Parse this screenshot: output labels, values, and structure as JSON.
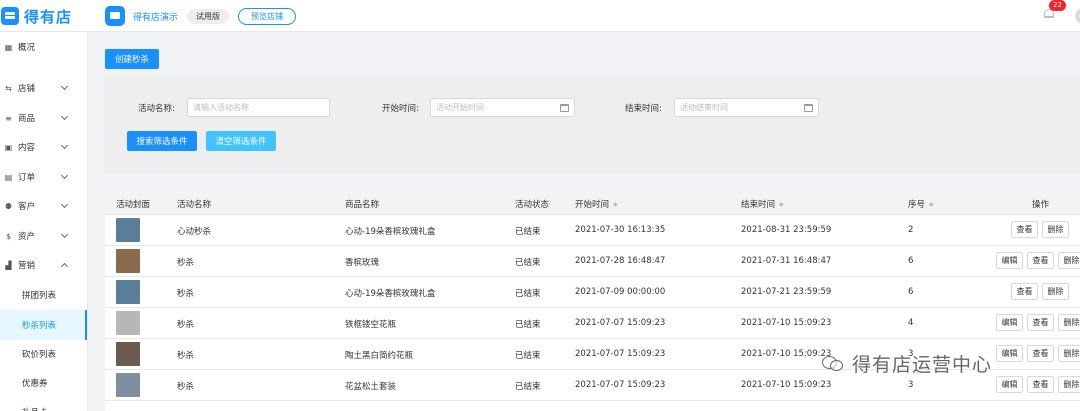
{
  "header": {
    "brand": "得有店",
    "store_name": "得有店演示",
    "trial_label": "试用版",
    "preview_label": "预览店铺",
    "notification_count": "22"
  },
  "sidebar": {
    "items": [
      {
        "icon": "grid-icon",
        "glyph": "▦",
        "label": "概况"
      },
      {
        "icon": "store-icon",
        "glyph": "⇆",
        "label": "店铺"
      },
      {
        "icon": "product-icon",
        "glyph": "≡",
        "label": "商品"
      },
      {
        "icon": "content-icon",
        "glyph": "▣",
        "label": "内容"
      },
      {
        "icon": "order-icon",
        "glyph": "▤",
        "label": "订单"
      },
      {
        "icon": "customer-icon",
        "glyph": "⚉",
        "label": "客户"
      },
      {
        "icon": "asset-icon",
        "glyph": "$",
        "label": "资产"
      },
      {
        "icon": "marketing-icon",
        "glyph": "▟",
        "label": "营销"
      }
    ],
    "sub_items": [
      "拼团列表",
      "秒杀列表",
      "砍价列表",
      "优惠券",
      "礼品卡"
    ]
  },
  "toolbar": {
    "create_label": "创建秒杀"
  },
  "filters": {
    "name_label": "活动名称:",
    "name_placeholder": "请输入活动名称",
    "start_label": "开始时间:",
    "start_placeholder": "活动开始时间",
    "end_label": "结束时间:",
    "end_placeholder": "活动结束时间",
    "search_label": "搜索筛选条件",
    "clear_label": "清空筛选条件"
  },
  "table": {
    "headers": [
      "活动封面",
      "活动名称",
      "商品名称",
      "活动状态",
      "开始时间",
      "结束时间",
      "序号",
      "操作"
    ],
    "rows": [
      {
        "name": "心动秒杀",
        "product": "心动-19朵香槟玫瑰礼盒",
        "status": "已结束",
        "start": "2021-07-30 16:13:35",
        "end": "2021-08-31 23:59:59",
        "seq": "2",
        "thumb": "#5a7d9a",
        "edit": false
      },
      {
        "name": "秒杀",
        "product": "香槟玫瑰",
        "status": "已结束",
        "start": "2021-07-28 16:48:47",
        "end": "2021-07-31 16:48:47",
        "seq": "6",
        "thumb": "#8a6a4c",
        "edit": true
      },
      {
        "name": "秒杀",
        "product": "心动-19朵香槟玫瑰礼盒",
        "status": "已结束",
        "start": "2021-07-09 00:00:00",
        "end": "2021-07-21 23:59:59",
        "seq": "6",
        "thumb": "#5a7d9a",
        "edit": false
      },
      {
        "name": "秒杀",
        "product": "铁框镂空花瓶",
        "status": "已结束",
        "start": "2021-07-07 15:09:23",
        "end": "2021-07-10 15:09:23",
        "seq": "4",
        "thumb": "#b7b7b7",
        "edit": true
      },
      {
        "name": "秒杀",
        "product": "陶土黑白简约花瓶",
        "status": "已结束",
        "start": "2021-07-07 15:09:23",
        "end": "2021-07-10 15:09:23",
        "seq": "3",
        "thumb": "#6b5a4e",
        "edit": true
      },
      {
        "name": "秒杀",
        "product": "花盆松土套装",
        "status": "已结束",
        "start": "2021-07-07 15:09:23",
        "end": "2021-07-10 15:09:23",
        "seq": "3",
        "thumb": "#7f8fa0",
        "edit": true
      }
    ],
    "action_edit": "编辑",
    "action_view": "查看",
    "action_delete": "删除"
  },
  "watermark": "得有店运营中心"
}
